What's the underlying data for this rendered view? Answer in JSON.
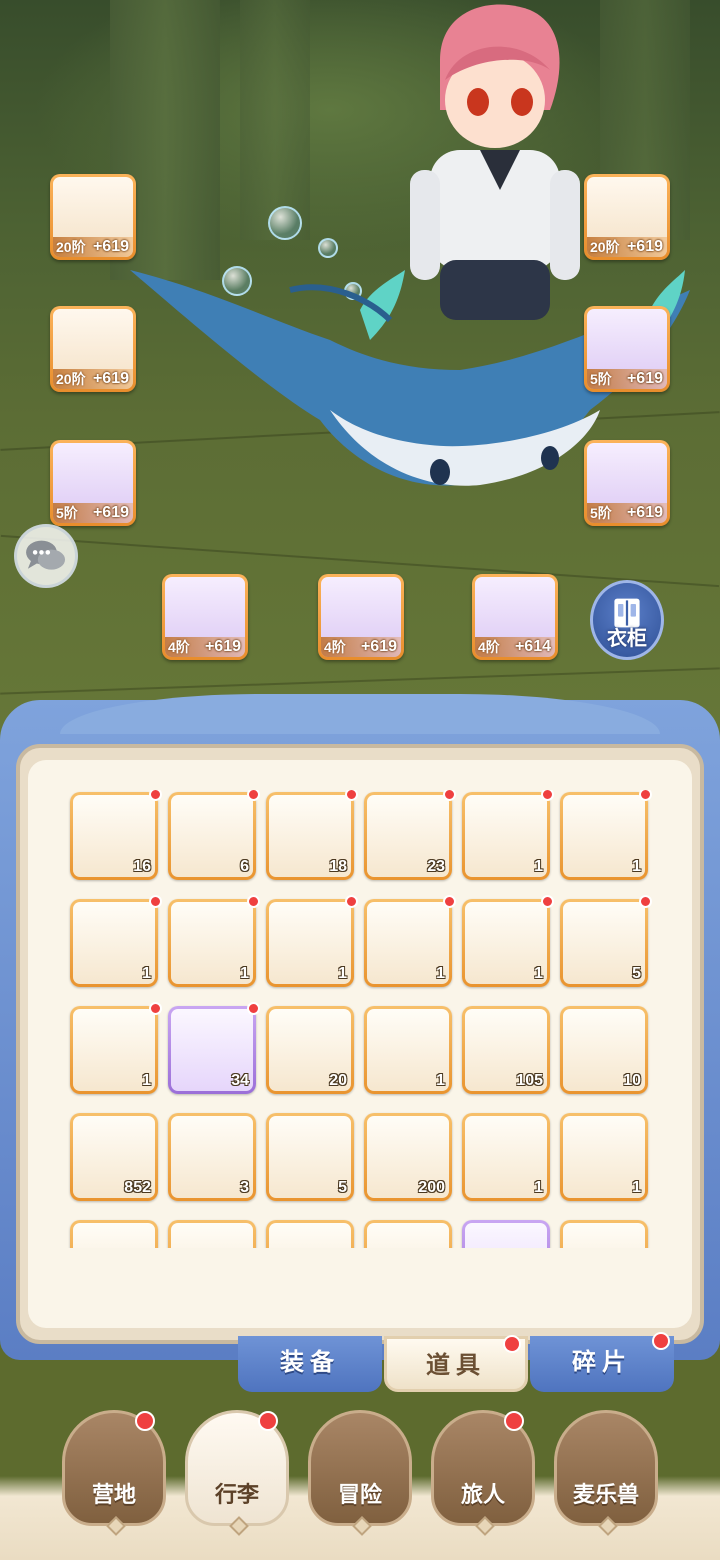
{
  "equip_slots": [
    {
      "name": "sword",
      "tier": "20阶",
      "plus": "+619",
      "rarity": "gold"
    },
    {
      "name": "armor",
      "tier": "20阶",
      "plus": "+619",
      "rarity": "gold"
    },
    {
      "name": "pants",
      "tier": "5阶",
      "plus": "+619",
      "rarity": "purple"
    },
    {
      "name": "helmet",
      "tier": "20阶",
      "plus": "+619",
      "rarity": "gold"
    },
    {
      "name": "gloves",
      "tier": "5阶",
      "plus": "+619",
      "rarity": "purple"
    },
    {
      "name": "boots",
      "tier": "5阶",
      "plus": "+619",
      "rarity": "purple"
    },
    {
      "name": "ring",
      "tier": "4阶",
      "plus": "+619",
      "rarity": "purple"
    },
    {
      "name": "necklace",
      "tier": "4阶",
      "plus": "+619",
      "rarity": "purple"
    },
    {
      "name": "amulet",
      "tier": "4阶",
      "plus": "+614",
      "rarity": "purple"
    }
  ],
  "wardrobe_label": "衣柜",
  "bag_items": [
    {
      "icon": "gold-shard-icon",
      "count": "16",
      "dot": true,
      "rarity": "gold"
    },
    {
      "icon": "purple-shard-icon",
      "count": "6",
      "dot": true,
      "rarity": "gold"
    },
    {
      "icon": "ore-icon",
      "count": "18",
      "dot": true,
      "rarity": "gold"
    },
    {
      "icon": "dark-shard-icon",
      "count": "23",
      "dot": true,
      "rarity": "gold"
    },
    {
      "icon": "wood-chest-icon",
      "count": "1",
      "dot": true,
      "rarity": "gold"
    },
    {
      "icon": "wood-chest-icon",
      "count": "1",
      "dot": true,
      "rarity": "gold"
    },
    {
      "icon": "wood-chest-icon",
      "count": "1",
      "dot": true,
      "rarity": "gold"
    },
    {
      "icon": "red-chest-icon",
      "count": "1",
      "dot": true,
      "rarity": "gold"
    },
    {
      "icon": "red-chest-icon",
      "count": "1",
      "dot": true,
      "rarity": "gold"
    },
    {
      "icon": "red-chest-icon",
      "count": "1",
      "dot": true,
      "rarity": "gold"
    },
    {
      "icon": "bell-icon",
      "count": "1",
      "dot": true,
      "rarity": "gold"
    },
    {
      "icon": "card-icon",
      "count": "5",
      "dot": true,
      "rarity": "gold"
    },
    {
      "icon": "purple-chest-icon",
      "count": "1",
      "dot": true,
      "rarity": "gold"
    },
    {
      "icon": "purple-shard-icon",
      "count": "34",
      "dot": true,
      "rarity": "purple"
    },
    {
      "icon": "jade-icon",
      "count": "20",
      "dot": false,
      "rarity": "gold"
    },
    {
      "icon": "scroll-icon",
      "count": "1",
      "dot": false,
      "rarity": "gold"
    },
    {
      "icon": "iron-icon",
      "count": "105",
      "dot": false,
      "rarity": "gold"
    },
    {
      "icon": "dark-card-icon",
      "count": "10",
      "dot": false,
      "rarity": "gold"
    },
    {
      "icon": "spoon-icon",
      "count": "852",
      "dot": false,
      "rarity": "gold"
    },
    {
      "icon": "sack-icon",
      "count": "3",
      "dot": false,
      "rarity": "gold"
    },
    {
      "icon": "cake-roll-icon",
      "count": "5",
      "dot": false,
      "rarity": "gold"
    },
    {
      "icon": "cream-roll-icon",
      "count": "200",
      "dot": false,
      "rarity": "gold"
    },
    {
      "icon": "drum-icon",
      "count": "1",
      "dot": false,
      "rarity": "gold"
    },
    {
      "icon": "drum-icon",
      "count": "1",
      "dot": false,
      "rarity": "gold"
    },
    {
      "icon": "feather-icon",
      "count": "",
      "dot": false,
      "rarity": "gold"
    },
    {
      "icon": "gem-icon",
      "count": "",
      "dot": false,
      "rarity": "gold"
    },
    {
      "icon": "gem-icon",
      "count": "",
      "dot": false,
      "rarity": "gold"
    },
    {
      "icon": "star-icon",
      "count": "",
      "dot": false,
      "rarity": "gold"
    },
    {
      "icon": "fish-icon",
      "count": "",
      "dot": false,
      "rarity": "purple"
    },
    {
      "icon": "pot-icon",
      "count": "",
      "dot": false,
      "rarity": "gold"
    }
  ],
  "sub_tabs": [
    {
      "label": "装备",
      "active": false,
      "dot": false
    },
    {
      "label": "道具",
      "active": true,
      "dot": true
    },
    {
      "label": "碎片",
      "active": false,
      "dot": true
    }
  ],
  "nav": [
    {
      "label": "营地",
      "active": false,
      "dot": true
    },
    {
      "label": "行李",
      "active": true,
      "dot": true
    },
    {
      "label": "冒险",
      "active": false,
      "dot": false
    },
    {
      "label": "旅人",
      "active": false,
      "dot": true
    },
    {
      "label": "麦乐兽",
      "active": false,
      "dot": false
    }
  ]
}
